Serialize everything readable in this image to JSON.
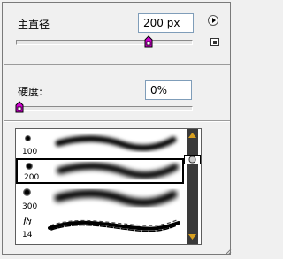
{
  "diameter": {
    "label": "主直径",
    "value": "200 px",
    "fraction": 0.68
  },
  "hardness": {
    "label": "硬度:",
    "value": "0%",
    "fraction": 0.0
  },
  "icons": {
    "flyout": "flyout-menu-icon",
    "create_preset": "create-preset-icon"
  },
  "brushes": [
    {
      "size": "100",
      "stroke": "soft-round"
    },
    {
      "size": "200",
      "stroke": "soft-round",
      "selected": true
    },
    {
      "size": "300",
      "stroke": "soft-round"
    },
    {
      "size": "14",
      "stroke": "chalk"
    }
  ],
  "colors": {
    "thumb_accent": "#d000d0",
    "scrollbar": "#3a3a3a",
    "arrow": "#d8a020"
  }
}
